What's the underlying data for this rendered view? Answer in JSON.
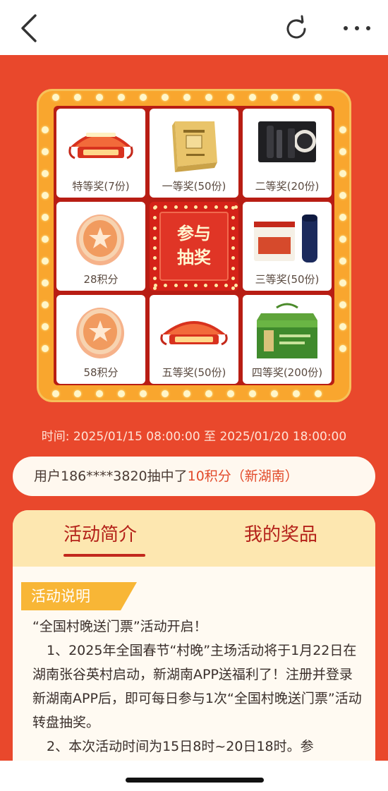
{
  "topbar": {
    "back_icon": "chevron-left-icon",
    "refresh_icon": "refresh-icon",
    "more_icon": "more-horizontal-icon"
  },
  "lottery": {
    "prizes": [
      {
        "label": "特等奖(7份)",
        "image": "ticket-banner-art"
      },
      {
        "label": "一等奖(50份)",
        "image": "gift-box-art"
      },
      {
        "label": "二等奖(20份)",
        "image": "thermos-set-art"
      },
      {
        "label": "28积分",
        "image": "coin-star-icon"
      },
      {
        "label": "三等奖(50份)",
        "image": "calendar-cup-art"
      },
      {
        "label": "58积分",
        "image": "coin-star-icon"
      },
      {
        "label": "五等奖(50份)",
        "image": "ticket-banner-art"
      },
      {
        "label": "四等奖(200份)",
        "image": "tea-gift-box-art"
      }
    ],
    "draw_button": {
      "line1": "参与",
      "line2": "抽奖"
    },
    "colors": {
      "frame": "#f9a62e",
      "inner": "#b81d14",
      "button": "#d52218"
    }
  },
  "event_time": "时间: 2025/01/15 08:00:00 至 2025/01/20 18:00:00",
  "ticker": {
    "prefix": "用户186****3820抽中了",
    "highlight": "10积分（新湖南）"
  },
  "panel": {
    "tabs": [
      {
        "label": "活动简介",
        "active": true
      },
      {
        "label": "我的奖品",
        "active": false
      }
    ],
    "section_title": "活动说明",
    "paragraphs": [
      "“全国村晚送门票”活动开启！",
      "1、2025年全国春节“村晚”主场活动将于1月22日在湖南张谷英村启动，新湖南APP送福利了！注册并登录新湖南APP后，即可每日参与1次“全国村晚送门票”活动转盘抽奖。",
      "2、本次活动时间为15日8时~20日18时。参"
    ]
  },
  "colors": {
    "background": "#e9482c",
    "accent_red": "#b4221a",
    "highlight": "#e24b2b",
    "tab_bg": "#fde7b0"
  }
}
